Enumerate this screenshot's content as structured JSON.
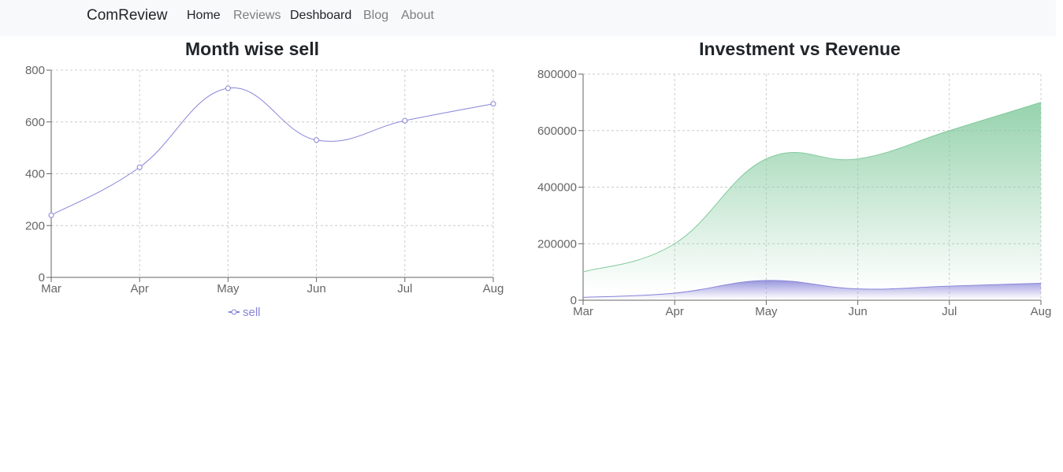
{
  "navbar": {
    "brand": "ComReview",
    "links": [
      {
        "label": "Home"
      },
      {
        "label": "Reviews"
      },
      {
        "label": "Deshboard"
      },
      {
        "label": "Blog"
      },
      {
        "label": "About"
      }
    ]
  },
  "colors": {
    "sell": "#8884d8",
    "revenue": "#82ca9d",
    "investment": "#8884d8",
    "grid": "#cccccc",
    "axis": "#666666"
  },
  "chart_data": [
    {
      "type": "line",
      "title": "Month wise sell",
      "categories": [
        "Mar",
        "Apr",
        "May",
        "Jun",
        "Jul",
        "Aug"
      ],
      "series": [
        {
          "name": "sell",
          "values": [
            240,
            425,
            730,
            530,
            605,
            670
          ]
        }
      ],
      "yticks": [
        0,
        200,
        400,
        600,
        800
      ],
      "ylim": [
        0,
        800
      ],
      "grid": true,
      "legend": "bottom-center"
    },
    {
      "type": "area",
      "title": "Investment vs Revenue",
      "categories": [
        "Mar",
        "Apr",
        "May",
        "Jun",
        "Jul",
        "Aug"
      ],
      "series": [
        {
          "values": [
            100000,
            200000,
            500000,
            500000,
            600000,
            700000
          ]
        },
        {
          "values": [
            10000,
            25000,
            70000,
            40000,
            50000,
            60000
          ]
        }
      ],
      "yticks": [
        0,
        200000,
        400000,
        600000,
        800000
      ],
      "ylim": [
        0,
        800000
      ],
      "grid": true
    }
  ]
}
